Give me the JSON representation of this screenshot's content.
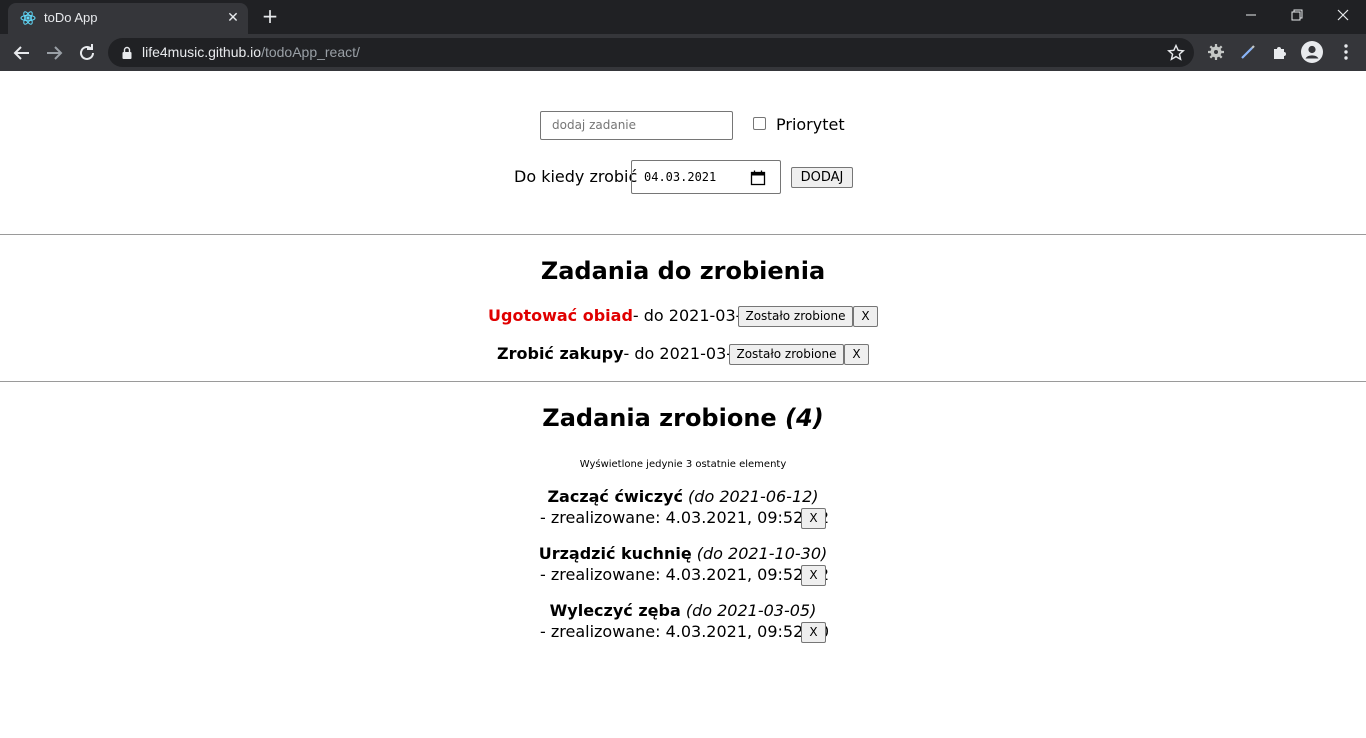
{
  "browser": {
    "tab_title": "toDo App",
    "new_tab_label": "+",
    "url_host": "life4music.github.io",
    "url_path": "/todoApp_react/"
  },
  "form": {
    "task_placeholder": "dodaj zadanie",
    "priority_label": "Priorytet",
    "priority_checked": false,
    "date_label": "Do kiedy zrobić",
    "date_value": "04.03.2021",
    "add_button": "DODAJ"
  },
  "todo_section": {
    "heading": "Zadania do zrobienia",
    "done_button": "Zostało zrobione",
    "delete_button": "X",
    "items": [
      {
        "name": "Ugotować obiad",
        "deadline_text": "- do 2021-03-04",
        "priority": true
      },
      {
        "name": "Zrobić zakupy",
        "deadline_text": "- do 2021-03-05",
        "priority": false
      }
    ]
  },
  "done_section": {
    "heading": "Zadania zrobione",
    "count_text": "(4)",
    "note": "Wyświetlone jedynie 3 ostatnie elementy",
    "delete_button": "X",
    "items": [
      {
        "name": "Zacząć ćwiczyć",
        "deadline_text": "(do 2021-06-12)",
        "done_text": "- zrealizowane: 4.03.2021, 09:52:32"
      },
      {
        "name": "Urządzić kuchnię",
        "deadline_text": "(do 2021-10-30)",
        "done_text": "- zrealizowane: 4.03.2021, 09:52:32"
      },
      {
        "name": "Wyleczyć zęba",
        "deadline_text": "(do 2021-03-05)",
        "done_text": "- zrealizowane: 4.03.2021, 09:52:30"
      }
    ]
  },
  "colors": {
    "priority_text": "#e00000",
    "chrome_dark": "#202124",
    "chrome_toolbar": "#35363a"
  }
}
